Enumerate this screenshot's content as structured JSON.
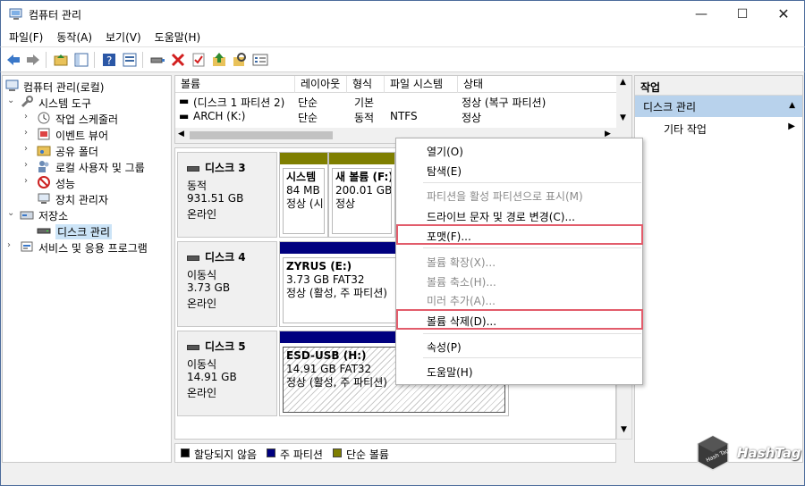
{
  "window": {
    "title": "컴퓨터 관리",
    "minimize": "—",
    "maximize": "☐",
    "close": "✕"
  },
  "menu": [
    "파일(F)",
    "동작(A)",
    "보기(V)",
    "도움말(H)"
  ],
  "toolbar": {
    "icons": [
      "back-icon",
      "forward-icon",
      "up-folder-icon",
      "show-tree-icon",
      "help-icon",
      "properties-icon",
      "connect-icon",
      "delete-icon",
      "checklist-icon",
      "up-arrow-icon",
      "search-icon",
      "panel-icon"
    ]
  },
  "tree": {
    "root": "컴퓨터 관리(로컬)",
    "system_tools": "시스템 도구",
    "task_scheduler": "작업 스케줄러",
    "event_viewer": "이벤트 뷰어",
    "shared_folders": "공유 폴더",
    "local_users": "로컬 사용자 및 그룹",
    "performance": "성능",
    "device_manager": "장치 관리자",
    "storage": "저장소",
    "disk_management": "디스크 관리",
    "services": "서비스 및 응용 프로그램"
  },
  "grid": {
    "headers": [
      "볼륨",
      "레이아웃",
      "형식",
      "파일 시스템",
      "상태"
    ],
    "rows": [
      {
        "volume": "(디스크 1 파티션 2)",
        "layout": "단순",
        "type": "기본",
        "fs": "",
        "status": "정상 (복구 파티션)"
      },
      {
        "volume": "ARCH (K:)",
        "layout": "단순",
        "type": "동적",
        "fs": "NTFS",
        "status": "정상"
      }
    ],
    "scroll_up": "▲",
    "scroll_down": "▼",
    "scroll_left": "◀",
    "scroll_right": "▶"
  },
  "disks": [
    {
      "name": "디스크 3",
      "type": "동적",
      "size": "931.51 GB",
      "state": "온라인",
      "partitions": [
        {
          "name": "시스템",
          "size": "84 MB",
          "status": "정상 (시"
        },
        {
          "name": "새 볼륨  (F:)",
          "size": "200.01 GB N",
          "status": "정상"
        }
      ]
    },
    {
      "name": "디스크 4",
      "type": "이동식",
      "size": "3.73 GB",
      "state": "온라인",
      "partitions": [
        {
          "name": "ZYRUS  (E:)",
          "size": "3.73 GB FAT32",
          "status": "정상 (활성, 주 파티션)"
        }
      ]
    },
    {
      "name": "디스크 5",
      "type": "이동식",
      "size": "14.91 GB",
      "state": "온라인",
      "partitions": [
        {
          "name": "ESD-USB  (H:)",
          "size": "14.91 GB FAT32",
          "status": "정상 (활성, 주 파티션)"
        }
      ]
    }
  ],
  "legend": [
    {
      "label": "할당되지 않음",
      "color": "#000000"
    },
    {
      "label": "주 파티션",
      "color": "#00007f"
    },
    {
      "label": "단순 볼륨",
      "color": "#7f7f00"
    }
  ],
  "actions": {
    "header": "작업",
    "section": "디스크 관리",
    "section_arrow": "▲",
    "more": "기타 작업",
    "more_arrow": "▶"
  },
  "context_menu": {
    "open": "열기(O)",
    "explore": "탐색(E)",
    "mark_active": "파티션을 활성 파티션으로 표시(M)",
    "change_letter": "드라이브 문자 및 경로 변경(C)...",
    "format": "포맷(F)...",
    "extend": "볼륨 확장(X)...",
    "shrink": "볼륨 축소(H)...",
    "add_mirror": "미러 추가(A)...",
    "delete": "볼륨 삭제(D)...",
    "properties": "속성(P)",
    "help": "도움말(H)"
  },
  "watermark": {
    "brand": "HashTag",
    "cube_text": "Hash Tag"
  }
}
